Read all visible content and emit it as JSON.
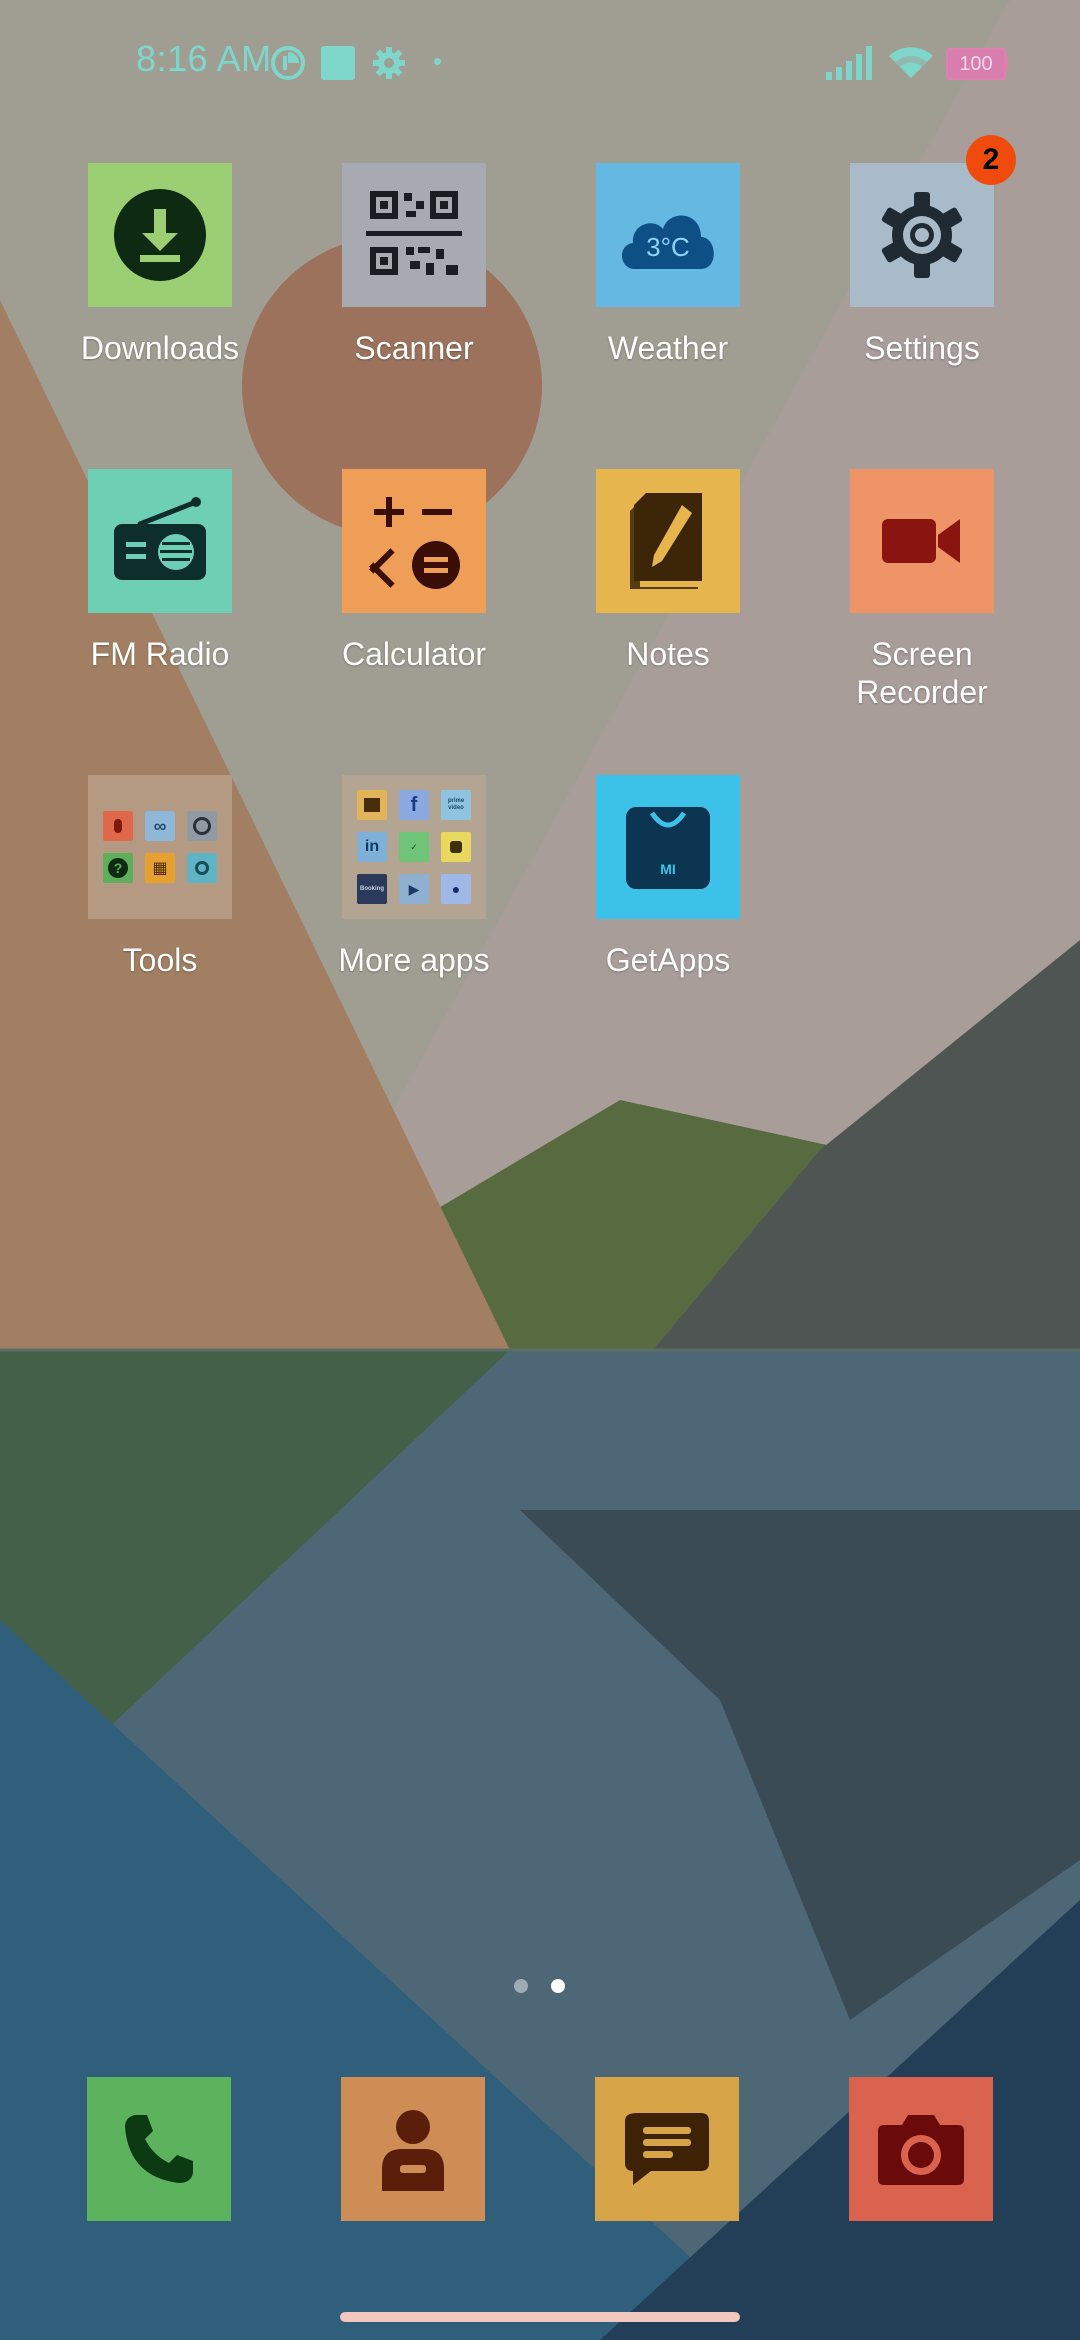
{
  "status_bar": {
    "time": "8:16 AM",
    "icons": [
      "data-saver-icon",
      "square-notification-icon",
      "gear-icon",
      "dot-icon",
      "signal-icon",
      "wifi-icon",
      "battery-icon"
    ],
    "battery_level": "100"
  },
  "apps": [
    {
      "label": "Downloads",
      "icon": "download-icon",
      "color": "#9ccf74"
    },
    {
      "label": "Scanner",
      "icon": "qr-code-icon",
      "color": "#a7aab0"
    },
    {
      "label": "Weather",
      "icon": "cloud-icon",
      "color": "#64b8e2",
      "temperature": "3°C"
    },
    {
      "label": "Settings",
      "icon": "gear-icon",
      "color": "#a9bac8",
      "badge": "2"
    },
    {
      "label": "FM Radio",
      "icon": "radio-icon",
      "color": "#6fcfb4"
    },
    {
      "label": "Calculator",
      "icon": "calculator-icon",
      "color": "#ee9e56"
    },
    {
      "label": "Notes",
      "icon": "note-pencil-icon",
      "color": "#e6b54d"
    },
    {
      "label": "Screen Recorder",
      "icon": "video-camera-icon",
      "color": "#ee9466"
    },
    {
      "label": "Tools",
      "icon": "folder-icon",
      "color": "#b49a82"
    },
    {
      "label": "More apps",
      "icon": "folder-icon",
      "color": "#b3a592",
      "mini_texts": [
        "f",
        "prime video",
        "in",
        "Booking"
      ]
    },
    {
      "label": "GetApps",
      "icon": "shopping-bag-icon",
      "color": "#3cc2e8",
      "logo_text": "MI"
    }
  ],
  "page_indicator": {
    "pages": 2,
    "current": 2
  },
  "dock": [
    {
      "name": "phone",
      "icon": "phone-icon",
      "color": "#5db35d"
    },
    {
      "name": "contacts",
      "icon": "person-icon",
      "color": "#cd8d55"
    },
    {
      "name": "messages",
      "icon": "message-icon",
      "color": "#d7a448"
    },
    {
      "name": "camera",
      "icon": "camera-icon",
      "color": "#d9634f"
    }
  ]
}
